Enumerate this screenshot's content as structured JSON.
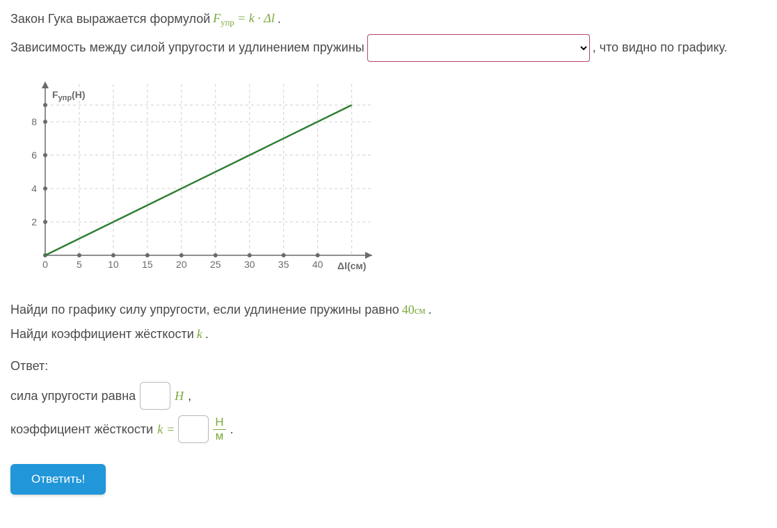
{
  "text": {
    "intro_a": "Закон Гука выражается формулой ",
    "formula_F": "F",
    "formula_sub": "упр",
    "formula_eq": " = ",
    "formula_k": "k",
    "formula_dot": " · ",
    "formula_delta": "Δ",
    "formula_l": "l",
    "period": ".",
    "dep_a": "Зависимость между силой упругости и удлинением пружины ",
    "dep_b": ", что видно по графику.",
    "task_a": "Найди по графику силу упругости, если удлинение пружины равно ",
    "task_value": "40",
    "task_unit": "см",
    "task_end": ".",
    "task_b": "Найди коэффициент жёсткости ",
    "task_b_k": "k",
    "answer_label": "Ответ:",
    "ans1_a": "сила упругости равна ",
    "ans1_unit": "Н",
    "ans1_end": ",",
    "ans2_a": "коэффициент жёсткости ",
    "ans2_k": "k",
    "ans2_eq": " = ",
    "frac_num": "Н",
    "frac_den": "м",
    "ans2_end": ".",
    "submit": "Ответить!"
  },
  "dropdown": {
    "selected": ""
  },
  "chart_data": {
    "type": "line",
    "title": "",
    "y_axis_label": "Fупр(Н)",
    "x_axis_label": "Δl(см)",
    "x_ticks": [
      0,
      5,
      10,
      15,
      20,
      25,
      30,
      35,
      40
    ],
    "y_ticks": [
      0,
      2,
      4,
      6,
      8
    ],
    "xlim": [
      0,
      48
    ],
    "ylim": [
      0,
      10
    ],
    "series": [
      {
        "name": "Fупр",
        "x": [
          0,
          45
        ],
        "y": [
          0,
          9
        ]
      }
    ]
  }
}
